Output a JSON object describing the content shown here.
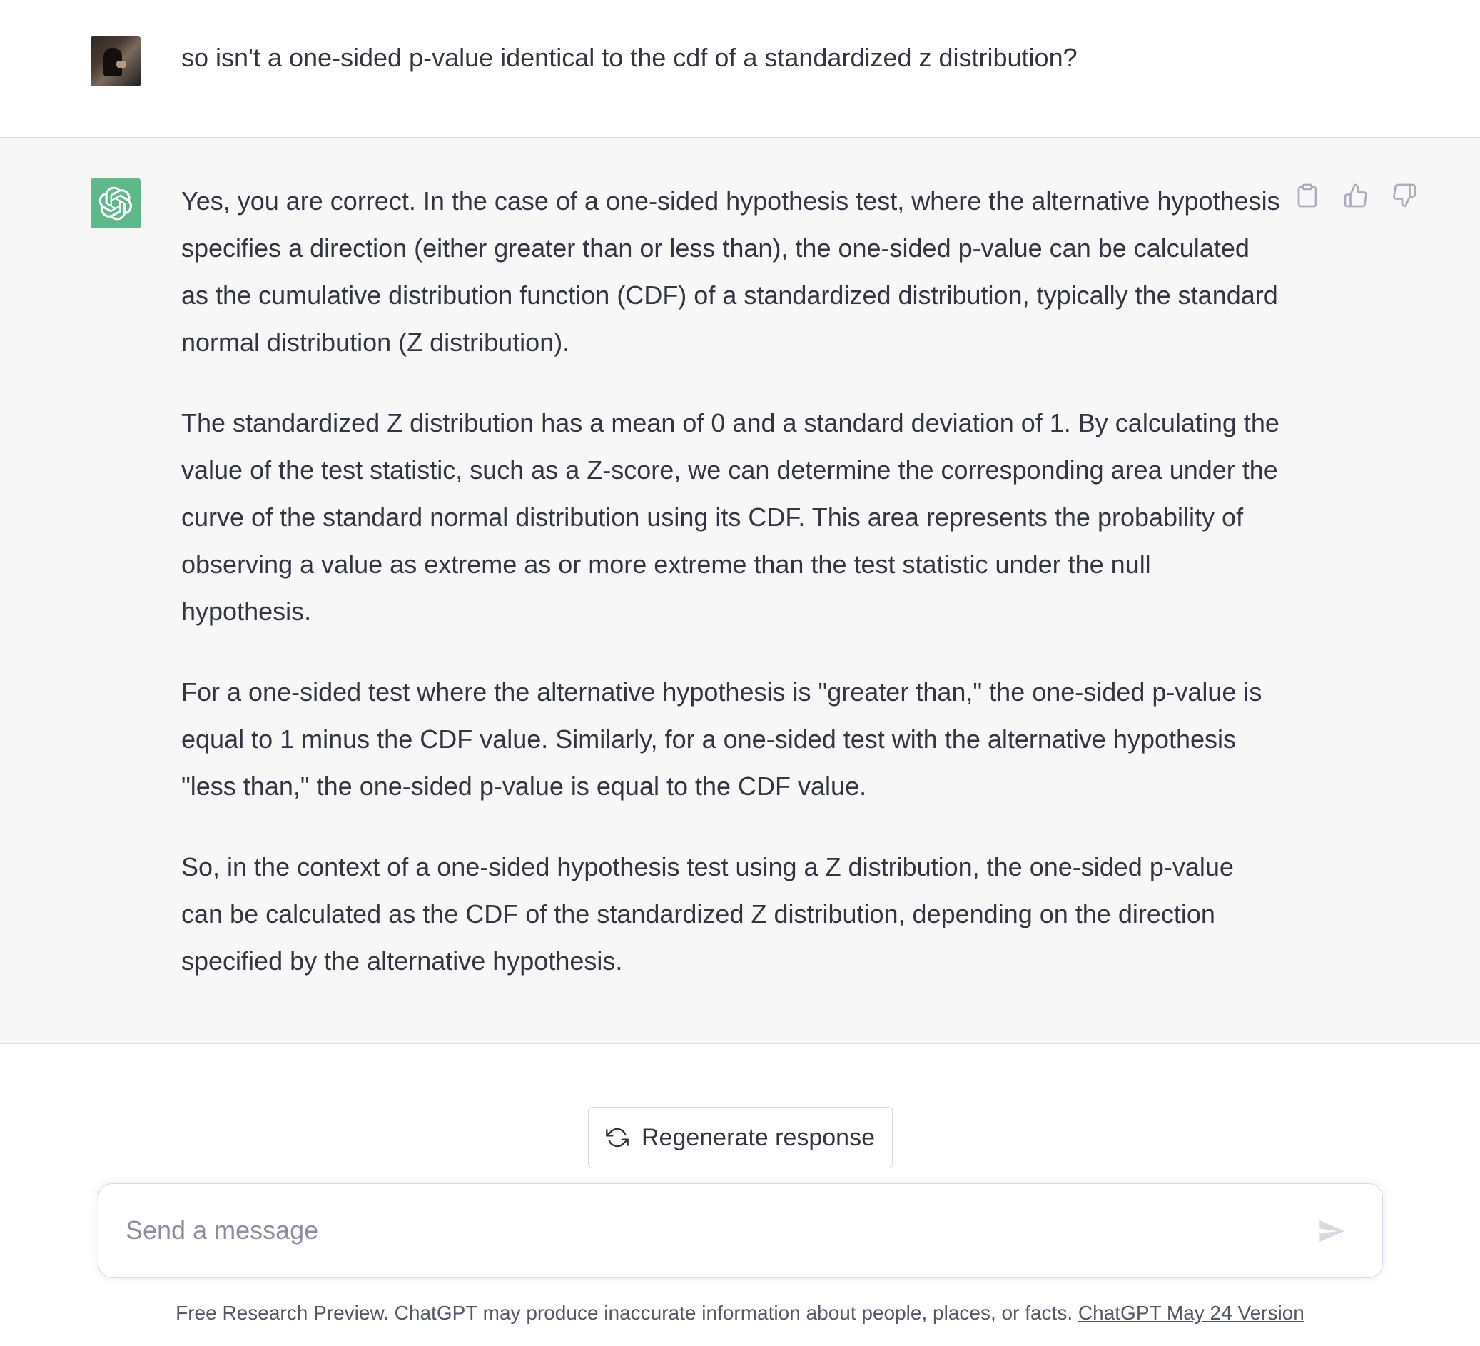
{
  "user_message": {
    "text": "so isn't a one-sided p-value identical to the cdf of a standardized z distribution?"
  },
  "assistant_message": {
    "paragraphs": [
      "Yes, you are correct. In the case of a one-sided hypothesis test, where the alternative hypothesis specifies a direction (either greater than or less than), the one-sided p-value can be calculated as the cumulative distribution function (CDF) of a standardized distribution, typically the standard normal distribution (Z distribution).",
      "The standardized Z distribution has a mean of 0 and a standard deviation of 1. By calculating the value of the test statistic, such as a Z-score, we can determine the corresponding area under the curve of the standard normal distribution using its CDF. This area represents the probability of observing a value as extreme as or more extreme than the test statistic under the null hypothesis.",
      "For a one-sided test where the alternative hypothesis is \"greater than,\" the one-sided p-value is equal to 1 minus the CDF value. Similarly, for a one-sided test with the alternative hypothesis \"less than,\" the one-sided p-value is equal to the CDF value.",
      "So, in the context of a one-sided hypothesis test using a Z distribution, the one-sided p-value can be calculated as the CDF of the standardized Z distribution, depending on the direction specified by the alternative hypothesis."
    ],
    "actions": [
      "clipboard-icon",
      "thumbs-up-icon",
      "thumbs-down-icon"
    ]
  },
  "regenerate": {
    "label": "Regenerate response",
    "icon": "refresh-icon"
  },
  "composer": {
    "placeholder": "Send a message",
    "value": "",
    "send_icon": "send-icon"
  },
  "footer": {
    "text": "Free Research Preview. ChatGPT may produce inaccurate information about people, places, or facts.",
    "link_text": "ChatGPT May 24 Version"
  },
  "colors": {
    "assistant_bg": "#f7f7f8",
    "gpt_avatar": "#5fb889",
    "text": "#343541",
    "muted": "#8e8ea0"
  }
}
